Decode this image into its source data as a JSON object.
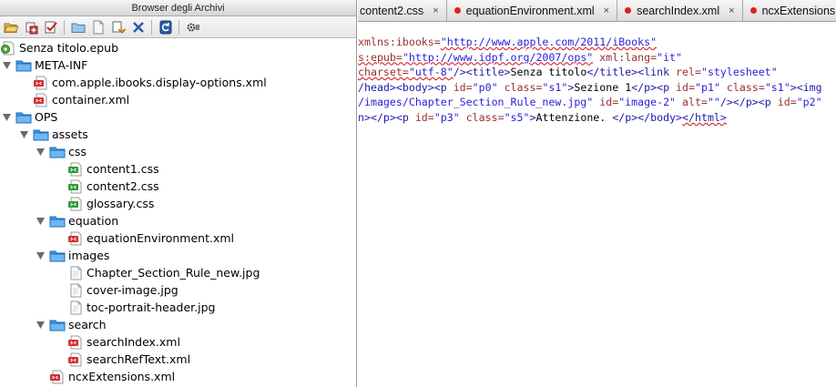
{
  "left": {
    "title": "Browser degli Archivi",
    "tree": [
      {
        "label": "Senza titolo.epub",
        "kind": "epub",
        "depth": 0,
        "toggle": "none"
      },
      {
        "label": "META-INF",
        "kind": "folder",
        "depth": 0,
        "toggle": "open"
      },
      {
        "label": "com.apple.ibooks.display-options.xml",
        "kind": "xml",
        "depth": 1,
        "toggle": "none"
      },
      {
        "label": "container.xml",
        "kind": "xml",
        "depth": 1,
        "toggle": "none"
      },
      {
        "label": "OPS",
        "kind": "folder",
        "depth": 0,
        "toggle": "open"
      },
      {
        "label": "assets",
        "kind": "folder",
        "depth": 1,
        "toggle": "open"
      },
      {
        "label": "css",
        "kind": "folder",
        "depth": 2,
        "toggle": "open"
      },
      {
        "label": "content1.css",
        "kind": "css",
        "depth": 3,
        "toggle": "none"
      },
      {
        "label": "content2.css",
        "kind": "css",
        "depth": 3,
        "toggle": "none"
      },
      {
        "label": "glossary.css",
        "kind": "css",
        "depth": 3,
        "toggle": "none"
      },
      {
        "label": "equation",
        "kind": "folder",
        "depth": 2,
        "toggle": "open"
      },
      {
        "label": "equationEnvironment.xml",
        "kind": "xml",
        "depth": 3,
        "toggle": "none"
      },
      {
        "label": "images",
        "kind": "folder",
        "depth": 2,
        "toggle": "open"
      },
      {
        "label": "Chapter_Section_Rule_new.jpg",
        "kind": "image",
        "depth": 3,
        "toggle": "none"
      },
      {
        "label": "cover-image.jpg",
        "kind": "image",
        "depth": 3,
        "toggle": "none"
      },
      {
        "label": "toc-portrait-header.jpg",
        "kind": "image",
        "depth": 3,
        "toggle": "none"
      },
      {
        "label": "search",
        "kind": "folder",
        "depth": 2,
        "toggle": "open"
      },
      {
        "label": "searchIndex.xml",
        "kind": "xml",
        "depth": 3,
        "toggle": "none"
      },
      {
        "label": "searchRefText.xml",
        "kind": "xml",
        "depth": 3,
        "toggle": "none"
      },
      {
        "label": "ncxExtensions.xml",
        "kind": "xml",
        "depth": 2,
        "toggle": "none"
      }
    ]
  },
  "tabs": [
    {
      "label": "content2.css",
      "modified": false
    },
    {
      "label": "equationEnvironment.xml",
      "modified": true
    },
    {
      "label": "searchIndex.xml",
      "modified": true
    },
    {
      "label": "ncxExtensions.xml",
      "modified": true
    }
  ],
  "code": [
    [
      {
        "t": "xmlns:ibooks=",
        "c": "attr"
      },
      {
        "t": "\"http://www.apple.com/2011/iBooks\"",
        "c": "val",
        "u": true
      }
    ],
    [
      {
        "t": "s:epub=",
        "c": "attr",
        "u": true
      },
      {
        "t": "\"http://www.idpf.org/2007/ops\"",
        "c": "val",
        "u": true
      },
      {
        "t": " ",
        "c": "txt"
      },
      {
        "t": "xml:lang=",
        "c": "attr"
      },
      {
        "t": "\"it\"",
        "c": "val"
      }
    ],
    [
      {
        "t": "charset=",
        "c": "attr",
        "u": true
      },
      {
        "t": "\"utf-8\"",
        "c": "val",
        "u": true
      },
      {
        "t": "/><title>",
        "c": "tag"
      },
      {
        "t": "Senza titolo",
        "c": "txt"
      },
      {
        "t": "</title><link ",
        "c": "tag"
      },
      {
        "t": "rel=",
        "c": "attr"
      },
      {
        "t": "\"stylesheet\"",
        "c": "val"
      }
    ],
    [
      {
        "t": "/head><body><p ",
        "c": "tag"
      },
      {
        "t": "id=",
        "c": "attr"
      },
      {
        "t": "\"p0\"",
        "c": "val"
      },
      {
        "t": " ",
        "c": "txt"
      },
      {
        "t": "class=",
        "c": "attr"
      },
      {
        "t": "\"s1\"",
        "c": "val"
      },
      {
        "t": ">",
        "c": "tag"
      },
      {
        "t": "Sezione 1",
        "c": "txt"
      },
      {
        "t": "</p><p ",
        "c": "tag"
      },
      {
        "t": "id=",
        "c": "attr"
      },
      {
        "t": "\"p1\"",
        "c": "val"
      },
      {
        "t": " ",
        "c": "txt"
      },
      {
        "t": "class=",
        "c": "attr"
      },
      {
        "t": "\"s1\"",
        "c": "val"
      },
      {
        "t": "><img",
        "c": "tag"
      }
    ],
    [
      {
        "t": "/images/Chapter_Section_Rule_new.jpg\"",
        "c": "val"
      },
      {
        "t": " ",
        "c": "txt"
      },
      {
        "t": "id=",
        "c": "attr"
      },
      {
        "t": "\"image-2\"",
        "c": "val"
      },
      {
        "t": " ",
        "c": "txt"
      },
      {
        "t": "alt=",
        "c": "attr"
      },
      {
        "t": "\"\"",
        "c": "val"
      },
      {
        "t": "/></p><p ",
        "c": "tag"
      },
      {
        "t": "id=",
        "c": "attr"
      },
      {
        "t": "\"p2\"",
        "c": "val"
      }
    ],
    [
      {
        "t": "n></p><p ",
        "c": "tag"
      },
      {
        "t": "id=",
        "c": "attr"
      },
      {
        "t": "\"p3\"",
        "c": "val"
      },
      {
        "t": " ",
        "c": "txt"
      },
      {
        "t": "class=",
        "c": "attr"
      },
      {
        "t": "\"s5\"",
        "c": "val"
      },
      {
        "t": ">",
        "c": "tag"
      },
      {
        "t": "Attenzione. ",
        "c": "txt"
      },
      {
        "t": "</p></body>",
        "c": "tag"
      },
      {
        "t": "</html>",
        "c": "tag",
        "u": true
      }
    ]
  ],
  "colors": {
    "folder": "#3d9ae8",
    "xml_badge": "#d32f2f",
    "css_badge": "#2e9a3c",
    "modified_dot": "#e02020",
    "attr": "#9b2f2f",
    "value": "#2a22d8",
    "tag": "#1a1aa8"
  },
  "icons": [
    "open-folder-icon",
    "add-file-icon",
    "validate-icon",
    "new-folder-icon",
    "new-file-icon",
    "import-icon",
    "delete-icon",
    "refresh-icon",
    "settings-icon"
  ]
}
